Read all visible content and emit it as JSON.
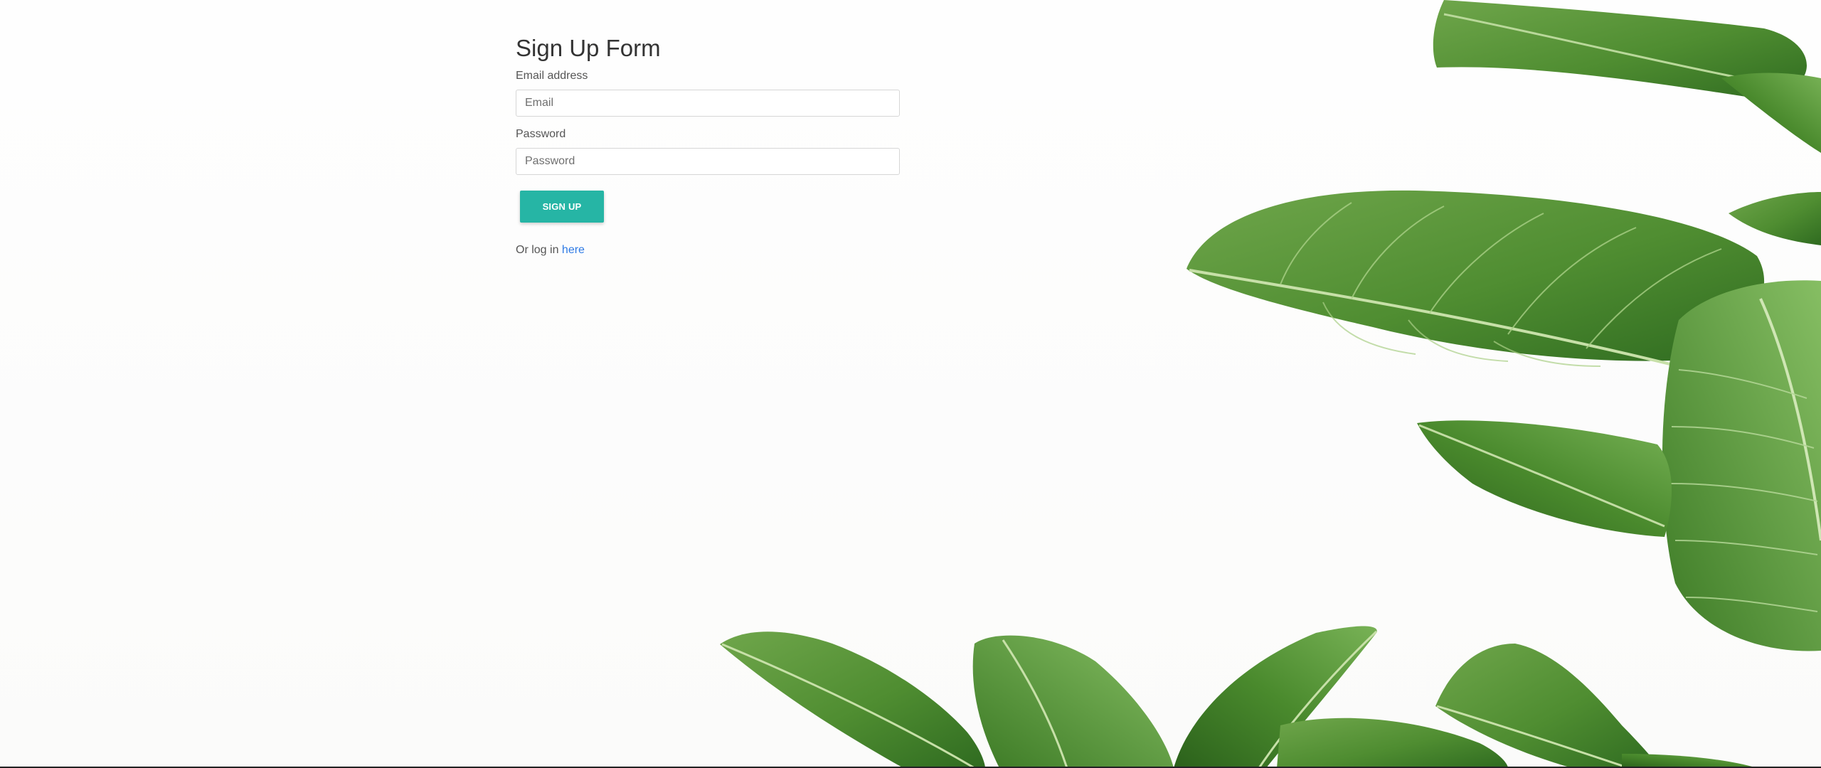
{
  "form": {
    "title": "Sign Up Form",
    "email_label": "Email address",
    "email_placeholder": "Email",
    "email_value": "",
    "password_label": "Password",
    "password_placeholder": "Password",
    "password_value": "",
    "signup_label": "SIGN UP",
    "login_prefix": "Or log in ",
    "login_link_label": "here"
  },
  "colors": {
    "accent": "#26b5a5",
    "link": "#2f7be5",
    "background": "#fdfdfc",
    "leaf_dark": "#3f7a2a",
    "leaf_light": "#7db45a"
  }
}
